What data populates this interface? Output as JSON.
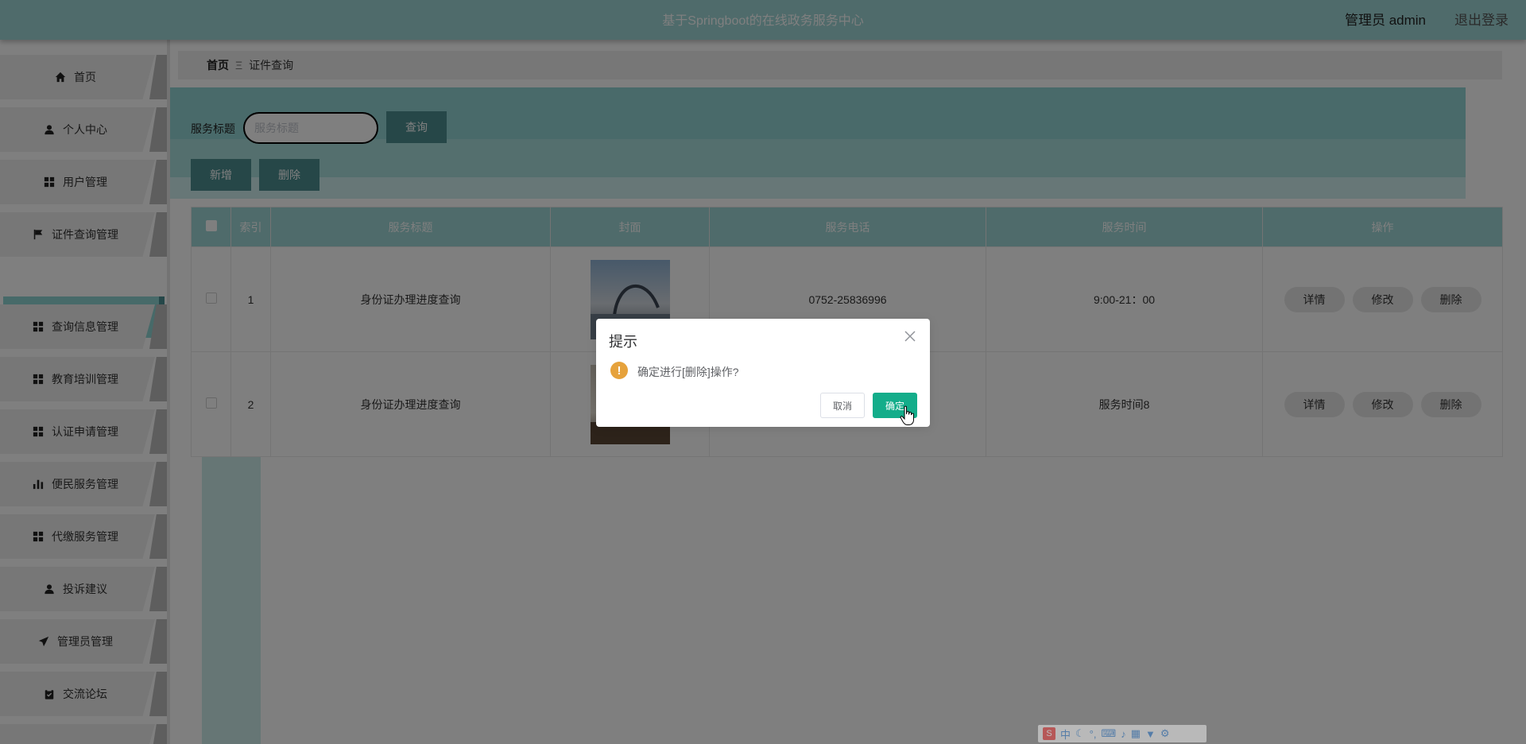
{
  "header": {
    "title": "基于Springboot的在线政务服务中心",
    "user": "管理员 admin",
    "logout": "退出登录"
  },
  "sidebar": {
    "items": [
      {
        "label": "首页",
        "icon": "home-icon"
      },
      {
        "label": "个人中心",
        "icon": "user-icon"
      },
      {
        "label": "用户管理",
        "icon": "grid-icon"
      },
      {
        "label": "证件查询管理",
        "icon": "flag-icon"
      },
      {
        "label": "查询信息管理",
        "icon": "grid-icon"
      },
      {
        "label": "教育培训管理",
        "icon": "grid-icon"
      },
      {
        "label": "认证申请管理",
        "icon": "grid-icon"
      },
      {
        "label": "便民服务管理",
        "icon": "bar-chart-icon"
      },
      {
        "label": "代缴服务管理",
        "icon": "grid-icon"
      },
      {
        "label": "投诉建议",
        "icon": "user-icon"
      },
      {
        "label": "管理员管理",
        "icon": "send-icon"
      },
      {
        "label": "交流论坛",
        "icon": "clipboard-icon"
      }
    ],
    "submenu_active": "证件查询"
  },
  "breadcrumb": {
    "home": "首页",
    "separator": "Ξ",
    "current": "证件查询"
  },
  "search": {
    "label": "服务标题",
    "placeholder": "服务标题",
    "value": "",
    "query_button": "查询"
  },
  "actions": {
    "add": "新增",
    "delete": "删除"
  },
  "table": {
    "columns": [
      "索引",
      "服务标题",
      "封面",
      "服务电话",
      "服务时间",
      "操作"
    ],
    "rows": [
      {
        "index": "1",
        "title": "身份证办理进度查询",
        "phone": "0752-25836996",
        "time": "9:00-21：00"
      },
      {
        "index": "2",
        "title": "身份证办理进度查询",
        "phone": "",
        "time": "服务时间8"
      }
    ],
    "row_actions": {
      "detail": "详情",
      "edit": "修改",
      "delete": "删除"
    }
  },
  "dialog": {
    "title": "提示",
    "message": "确定进行[删除]操作?",
    "cancel": "取消",
    "confirm": "确定",
    "warning_symbol": "!"
  },
  "ime": {
    "lang": "中"
  },
  "colors": {
    "accent": "#9fd6d6",
    "button": "#4c8f90",
    "confirm": "#13ad8a",
    "warning": "#e6a23c"
  }
}
